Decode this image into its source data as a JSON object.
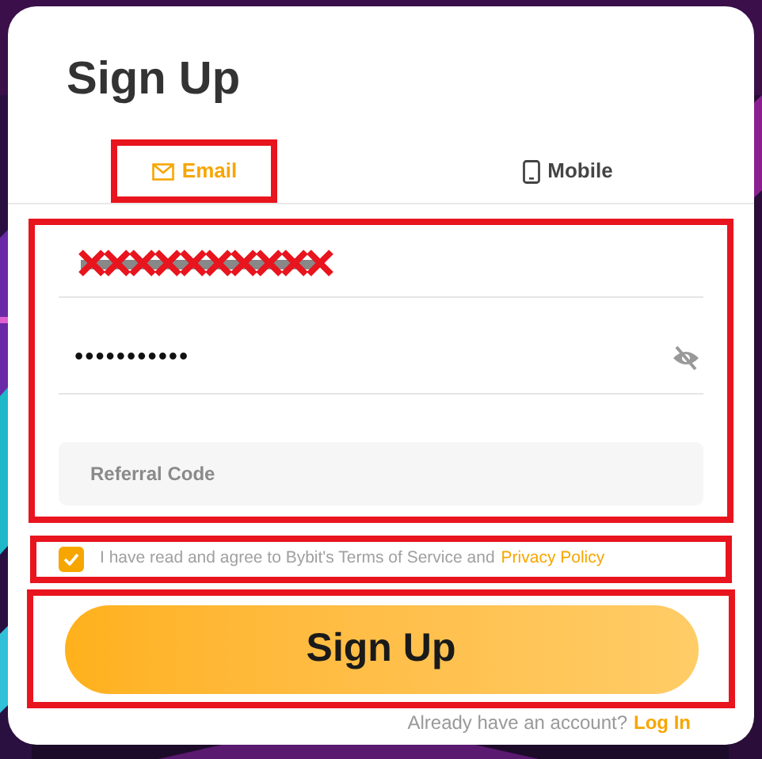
{
  "title": "Sign Up",
  "tabs": [
    {
      "label": "Email",
      "selected": true,
      "highlighted": true
    },
    {
      "label": "Mobile",
      "selected": false,
      "highlighted": false
    }
  ],
  "form": {
    "highlighted": true,
    "email": {
      "redacted": true
    },
    "password": {
      "value": "•••••••••••"
    },
    "referral": {
      "placeholder": "Referral Code"
    }
  },
  "agreement": {
    "checked": true,
    "highlighted": true,
    "text": "I have read and agree to Bybit's Terms of Service and",
    "link": "Privacy Policy"
  },
  "submit": {
    "label": "Sign Up",
    "highlighted": true
  },
  "footer": {
    "text": "Already have an account?",
    "link": "Log In"
  }
}
